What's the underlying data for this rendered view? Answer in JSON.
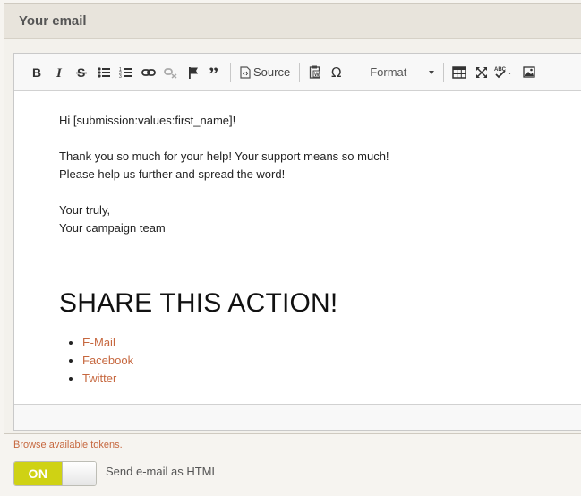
{
  "panel": {
    "title": "Your email"
  },
  "toolbar": {
    "source_label": "Source",
    "format_label": "Format",
    "icons": [
      "bold-icon",
      "italic-icon",
      "strikethrough-icon",
      "bulleted-list-icon",
      "numbered-list-icon",
      "link-icon",
      "unlink-icon",
      "anchor-flag-icon",
      "blockquote-icon",
      "source-icon",
      "paste-from-word-icon",
      "special-character-icon",
      "table-icon",
      "maximize-icon",
      "spellcheck-icon",
      "image-icon"
    ]
  },
  "content": {
    "greeting": "Hi [submission:values:first_name]!",
    "line1": "Thank you so much for your help! Your support means so much!",
    "line2": "Please help us further and spread the word!",
    "signoff1": "Your truly,",
    "signoff2": "Your campaign team",
    "heading": "SHARE THIS ACTION!",
    "share_links": [
      "E-Mail",
      "Facebook",
      "Twitter"
    ]
  },
  "tokens_link": "Browse available tokens.",
  "toggle": {
    "state_label": "ON",
    "label": "Send e-mail as HTML"
  },
  "colors": {
    "link": "#c6673e",
    "toggle_on": "#cfd214"
  }
}
